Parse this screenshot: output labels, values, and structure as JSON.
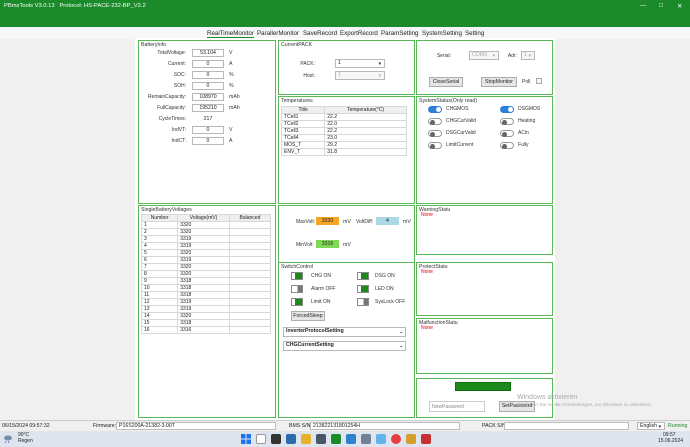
{
  "app": {
    "title": "PBmsTools V3.0.13",
    "protocol": "Protocol: HS-PACE-232-BP_V2.2"
  },
  "tabs": [
    "RealTimeMonitor",
    "ParallerMonitor",
    "SaveRecord",
    "ExportRecord",
    "ParamSetting",
    "SystemSetting",
    "Setting"
  ],
  "battery_info": {
    "title": "BatteryInfo",
    "fields": [
      {
        "label": "TotalVoltage:",
        "value": "53.104",
        "unit": "V"
      },
      {
        "label": "Current:",
        "value": "0",
        "unit": "A"
      },
      {
        "label": "SOC:",
        "value": "0",
        "unit": "%"
      },
      {
        "label": "SOH:",
        "value": "0",
        "unit": "%"
      },
      {
        "label": "RemainCapacity:",
        "value": "108970",
        "unit": "mAh"
      },
      {
        "label": "FullCapacity:",
        "value": "195210",
        "unit": "mAh"
      },
      {
        "label": "CycleTimes:",
        "value": "217",
        "unit": ""
      },
      {
        "label": "IndVT:",
        "value": "0",
        "unit": "V"
      },
      {
        "label": "IndCT:",
        "value": "0",
        "unit": "A"
      }
    ]
  },
  "current_pack": {
    "title": "CurrentPACK",
    "pack_label": "PACK:",
    "pack_value": "1",
    "host_label": "Host:",
    "host_value": "1"
  },
  "temperatures": {
    "title": "Temperatures",
    "headers": [
      "Title",
      "Temperature(°C)"
    ],
    "rows": [
      [
        "TCell1",
        "22.2"
      ],
      [
        "TCell2",
        "22.0"
      ],
      [
        "TCell3",
        "22.2"
      ],
      [
        "TCell4",
        "23.0"
      ],
      [
        "MOS_T",
        "29.2"
      ],
      [
        "ENV_T",
        "31.8"
      ]
    ]
  },
  "serial": {
    "serial_label": "Serial:",
    "serial_value": "COM3",
    "adr_label": "Adr:",
    "adr_value": "1",
    "close_serial": "CloseSerial",
    "stop_monitor": "StopMonitor",
    "poll_label": "Poll"
  },
  "system_status": {
    "title": "SystemStatus(Only read)",
    "items": [
      {
        "label": "CHGMOS",
        "on": true
      },
      {
        "label": "DSGMOS",
        "on": true
      },
      {
        "label": "CHGCurValid",
        "on": false
      },
      {
        "label": "Heating",
        "on": false
      },
      {
        "label": "DSGCurValid",
        "on": false
      },
      {
        "label": "ACin",
        "on": false
      },
      {
        "label": "LimitCurrent",
        "on": false
      },
      {
        "label": "Fully",
        "on": false
      }
    ]
  },
  "cell_voltages": {
    "title": "SingleBatteryVoltages",
    "headers": [
      "Number",
      "Voltage(mV)",
      "Balanced"
    ],
    "rows": [
      [
        "1",
        "3320",
        ""
      ],
      [
        "2",
        "3320",
        ""
      ],
      [
        "3",
        "3319",
        ""
      ],
      [
        "4",
        "3319",
        ""
      ],
      [
        "5",
        "3320",
        ""
      ],
      [
        "6",
        "3319",
        ""
      ],
      [
        "7",
        "3320",
        ""
      ],
      [
        "8",
        "3320",
        ""
      ],
      [
        "9",
        "3318",
        ""
      ],
      [
        "10",
        "3318",
        ""
      ],
      [
        "11",
        "3318",
        ""
      ],
      [
        "12",
        "3319",
        ""
      ],
      [
        "13",
        "3319",
        ""
      ],
      [
        "14",
        "3320",
        ""
      ],
      [
        "15",
        "3318",
        ""
      ],
      [
        "16",
        "3316",
        ""
      ]
    ]
  },
  "volt_summary": {
    "max_label": "MaxVolt:",
    "max_value": "3320",
    "max_color": "#f5a623",
    "diff_label": "VoltDiff:",
    "diff_value": "4",
    "diff_color": "#add8e6",
    "min_label": "MinVolt:",
    "min_value": "3316",
    "min_color": "#7ed957",
    "unit": "mV"
  },
  "switch_control": {
    "title": "SwitchControl",
    "items": [
      {
        "label": "CHG ON",
        "on": true
      },
      {
        "label": "DSG ON",
        "on": true
      },
      {
        "label": "Alarm OFF",
        "on": false
      },
      {
        "label": "LED ON",
        "on": true
      },
      {
        "label": "Limit ON",
        "on": true
      },
      {
        "label": "SysLock OFF",
        "on": false
      }
    ],
    "forced_sleep": "ForcedSleep",
    "inverter_setting": "InverterProtocolSetting",
    "chg_current_setting": "CHGCurrentSetting"
  },
  "warning": {
    "title": "WarningStatu",
    "value": "None"
  },
  "protect": {
    "title": "ProtectStatu",
    "value": "None"
  },
  "malfunction": {
    "title": "MalfunctionStatu",
    "value": "None"
  },
  "password": {
    "placeholder": "NewPassword",
    "set_button": "SetPassword"
  },
  "watermark": {
    "line1": "Windows aktivieren",
    "line2": "Wechseln Sie zu den Einstellungen, um Windows zu aktivieren."
  },
  "statusbar": {
    "datetime": "06/15/2024 09:57:32",
    "firmware_label": "Firmware:",
    "firmware_value": "P16S200A-21382-3.00T",
    "bms_sn_label": "BMS S/N:",
    "bms_sn_value": "213822131801254H",
    "pack_sn_label": "PACK S/N:",
    "language": "English",
    "state": "Running",
    "state_color": "#1a8a2a"
  },
  "taskbar": {
    "weather_temp": "90°C",
    "weather_text": "Regen",
    "time": "09:57",
    "date": "15.06.2024"
  },
  "colors": {
    "accent": "#1a8a2a",
    "panel_border": "#58b858",
    "toggle_on": "#2d7ed8",
    "alert_text": "#dd0000"
  }
}
